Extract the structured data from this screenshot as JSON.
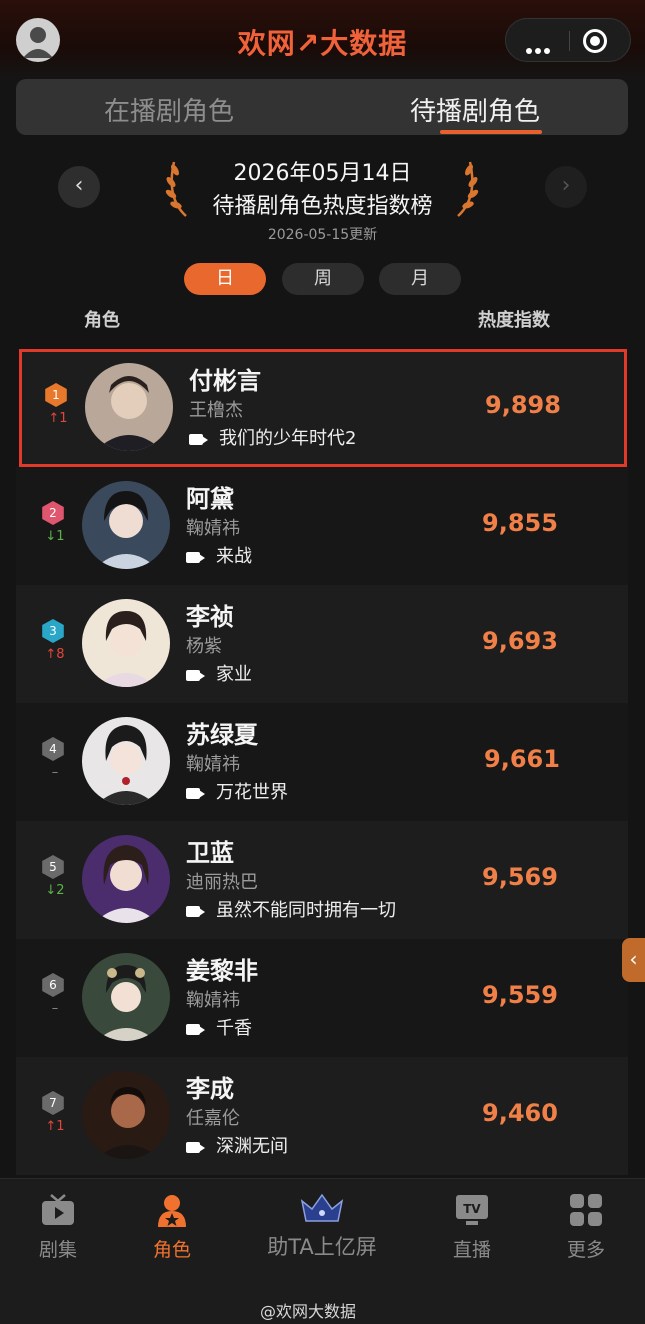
{
  "header": {
    "brand": "欢网↗大数据"
  },
  "tabs": [
    {
      "label": "在播剧角色",
      "active": false
    },
    {
      "label": "待播剧角色",
      "active": true
    }
  ],
  "ranking": {
    "prev_symbol": "‹",
    "next_symbol": "›",
    "date_title": "2026年05月14日",
    "title": "待播剧角色热度指数榜",
    "update_note": "2026-05-15更新"
  },
  "periods": [
    "日",
    "周",
    "月"
  ],
  "active_period": "日",
  "columns": {
    "role": "角色",
    "heat": "热度指数"
  },
  "rows": [
    {
      "rank": "1",
      "change": "↑1",
      "trend": "up",
      "character": "付彬言",
      "actor": "王橹杰",
      "show": "我们的少年时代2",
      "score": "9,898",
      "badge_color": "#e8792c"
    },
    {
      "rank": "2",
      "change": "↓1",
      "trend": "down",
      "character": "阿黛",
      "actor": "鞠婧祎",
      "show": "来战",
      "score": "9,855",
      "badge_color": "#e0566e"
    },
    {
      "rank": "3",
      "change": "↑8",
      "trend": "up",
      "character": "李祯",
      "actor": "杨紫",
      "show": "家业",
      "score": "9,693",
      "badge_color": "#2aa6c8"
    },
    {
      "rank": "4",
      "change": "–",
      "trend": "flat",
      "character": "苏绿夏",
      "actor": "鞠婧祎",
      "show": "万花世界",
      "score": "9,661",
      "badge_color": "#6b6b6b"
    },
    {
      "rank": "5",
      "change": "↓2",
      "trend": "down",
      "character": "卫蓝",
      "actor": "迪丽热巴",
      "show": "虽然不能同时拥有一切",
      "score": "9,569",
      "badge_color": "#6b6b6b"
    },
    {
      "rank": "6",
      "change": "–",
      "trend": "flat",
      "character": "姜黎非",
      "actor": "鞠婧祎",
      "show": "千香",
      "score": "9,559",
      "badge_color": "#6b6b6b"
    },
    {
      "rank": "7",
      "change": "↑1",
      "trend": "up",
      "character": "李成",
      "actor": "任嘉伦",
      "show": "深渊无间",
      "score": "9,460",
      "badge_color": "#6b6b6b"
    }
  ],
  "side_tab": "‹",
  "bottom_nav": [
    {
      "label": "剧集",
      "icon": "tv-play-icon",
      "active": false
    },
    {
      "label": "角色",
      "icon": "character-star-icon",
      "active": true
    },
    {
      "label": "助TA上亿屏",
      "icon": "crown-icon",
      "active": false
    },
    {
      "label": "直播",
      "icon": "live-tv-icon",
      "active": false
    },
    {
      "label": "更多",
      "icon": "grid-icon",
      "active": false
    }
  ],
  "watermark": "@欢网大数据",
  "colors": {
    "accent": "#e8682d",
    "score": "#f08048",
    "highlight_border": "#e03a2a",
    "trend_up": "#e0473a",
    "trend_down": "#5ab34a"
  }
}
